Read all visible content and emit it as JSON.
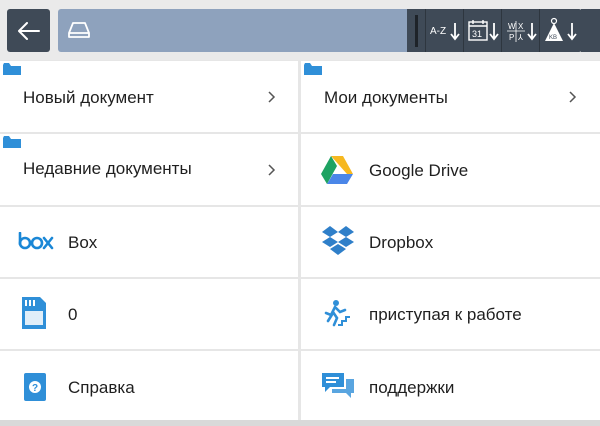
{
  "toolbar": {
    "back_icon": "arrow-left-icon",
    "path_icon": "drive-icon",
    "sort_buttons": [
      {
        "icon": "sort-alpha-icon",
        "text": "A-Z"
      },
      {
        "icon": "sort-date-icon",
        "text": "31"
      },
      {
        "icon": "sort-type-icon",
        "text": "W X P"
      },
      {
        "icon": "sort-size-icon",
        "text": "KB"
      }
    ]
  },
  "items": [
    {
      "label": "Новый документ",
      "icon": "folder-icon",
      "chevron": true
    },
    {
      "label": "Мои документы",
      "icon": "folder-icon",
      "chevron": true
    },
    {
      "label": "Недавние документы",
      "icon": "folder-icon",
      "chevron": true
    },
    {
      "label": "Google Drive",
      "icon": "google-drive-icon",
      "chevron": false
    },
    {
      "label": "Box",
      "icon": "box-icon",
      "chevron": false
    },
    {
      "label": "Dropbox",
      "icon": "dropbox-icon",
      "chevron": false
    },
    {
      "label": "0",
      "icon": "sd-card-icon",
      "chevron": false
    },
    {
      "label": "приступая к работе",
      "icon": "getting-started-icon",
      "chevron": false
    },
    {
      "label": "Справка",
      "icon": "help-icon",
      "chevron": false
    },
    {
      "label": "поддержки",
      "icon": "support-chat-icon",
      "chevron": false
    }
  ],
  "colors": {
    "toolbar_dark": "#3f4a57",
    "path_bar": "#8ea2bd",
    "folder_blue": "#2f8fd8",
    "box_blue": "#1a87d6",
    "dropbox_blue": "#2f7fc9"
  }
}
